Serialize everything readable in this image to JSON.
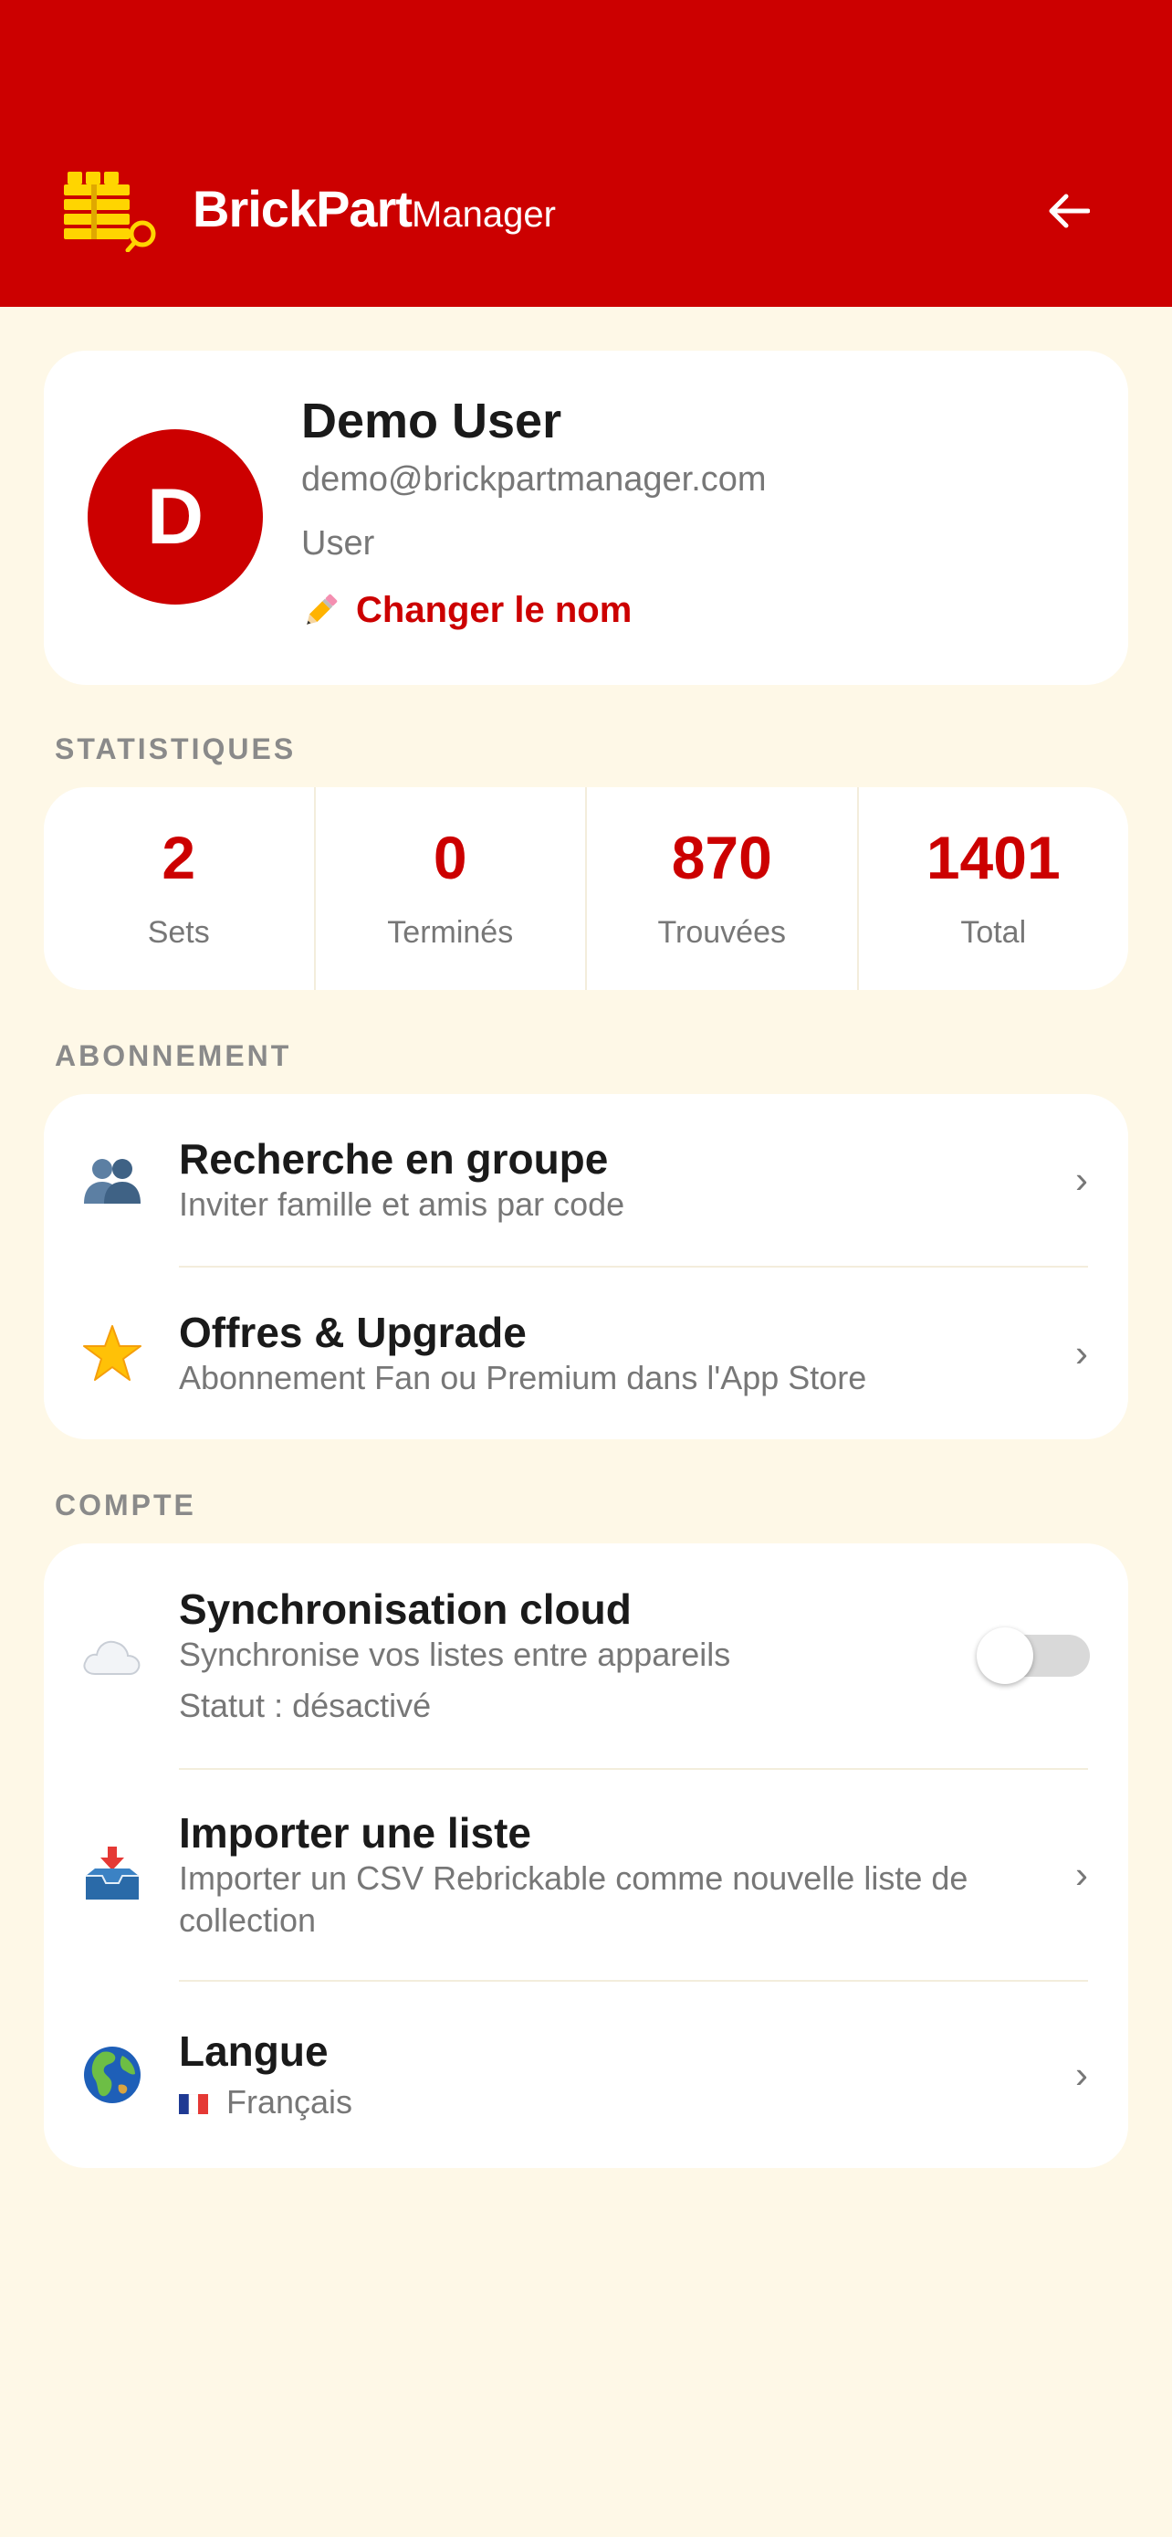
{
  "header": {
    "brand_bold": "BrickPart",
    "brand_light": "Manager",
    "color": "#CC0000"
  },
  "profile": {
    "initial": "D",
    "name": "Demo User",
    "email": "demo@brickpartmanager.com",
    "role": "User",
    "rename_label": "Changer le nom"
  },
  "stats": {
    "section_label": "STATISTIQUES",
    "items": [
      {
        "value": "2",
        "label": "Sets"
      },
      {
        "value": "0",
        "label": "Terminés"
      },
      {
        "value": "870",
        "label": "Trouvées"
      },
      {
        "value": "1401",
        "label": "Total"
      }
    ]
  },
  "subscription": {
    "section_label": "ABONNEMENT",
    "items": [
      {
        "icon": "group-icon",
        "title": "Recherche en groupe",
        "subtitle": "Inviter famille et amis par code"
      },
      {
        "icon": "star-icon",
        "title": "Offres & Upgrade",
        "subtitle": "Abonnement Fan ou Premium dans l'App Store"
      }
    ]
  },
  "account": {
    "section_label": "COMPTE",
    "sync": {
      "icon": "cloud-icon",
      "title": "Synchronisation cloud",
      "subtitle": "Synchronise vos listes entre appareils",
      "status": "Statut : désactivé",
      "enabled": false
    },
    "import": {
      "icon": "inbox-tray-icon",
      "title": "Importer une liste",
      "subtitle": "Importer un CSV Rebrickable comme nouvelle liste de collection"
    },
    "language": {
      "icon": "globe-icon",
      "title": "Langue",
      "value": "Français"
    }
  }
}
